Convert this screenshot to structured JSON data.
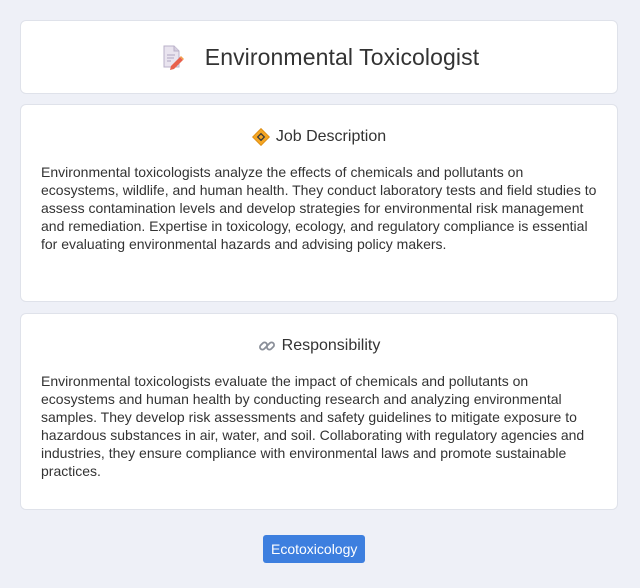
{
  "header": {
    "title": "Environmental Toxicologist",
    "icon": "document-pencil-icon"
  },
  "sections": [
    {
      "heading": "Job Description",
      "icon": "warning-sign-icon",
      "text": "Environmental toxicologists analyze the effects of chemicals and pollutants on ecosystems, wildlife, and human health. They conduct laboratory tests and field studies to assess contamination levels and develop strategies for environmental risk management and remediation. Expertise in toxicology, ecology, and regulatory compliance is essential for evaluating environmental hazards and advising policy makers."
    },
    {
      "heading": "Responsibility",
      "icon": "link-icon",
      "text": "Environmental toxicologists evaluate the impact of chemicals and pollutants on ecosystems and human health by conducting research and analyzing environmental samples. They develop risk assessments and safety guidelines to mitigate exposure to hazardous substances in air, water, and soil. Collaborating with regulatory agencies and industries, they ensure compliance with environmental laws and promote sustainable practices."
    }
  ],
  "tags": [
    "Ecotoxicology"
  ],
  "colors": {
    "background": "#eef0f7",
    "card": "#ffffff",
    "tag_background": "#3d7fdf",
    "tag_text": "#ffffff"
  }
}
